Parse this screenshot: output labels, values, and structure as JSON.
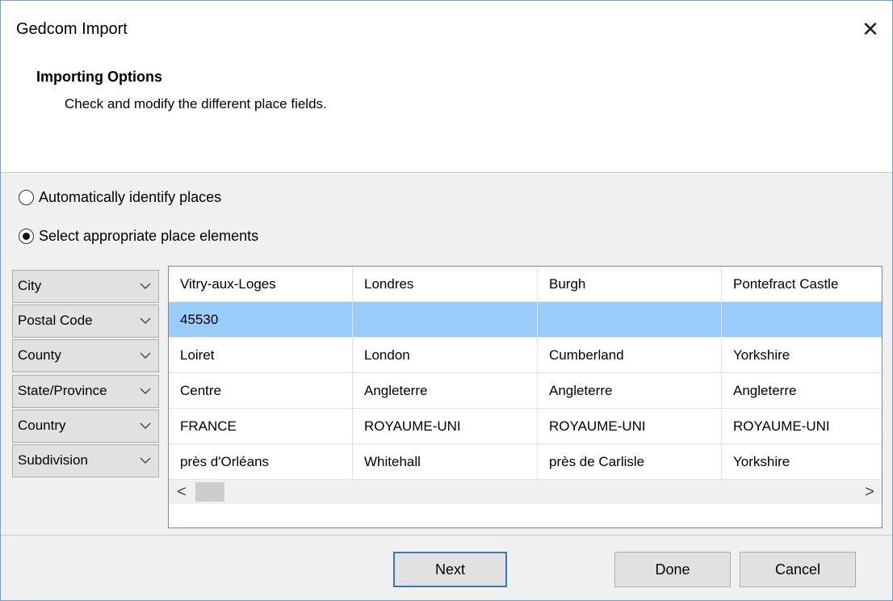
{
  "window": {
    "title": "Gedcom Import",
    "close_glyph": "✕"
  },
  "header": {
    "title": "Importing Options",
    "subtitle": "Check and modify the different place fields."
  },
  "options": {
    "auto_label": "Automatically identify places",
    "select_label": "Select appropriate place elements",
    "selected": "select"
  },
  "fields": [
    {
      "label": "City"
    },
    {
      "label": "Postal Code"
    },
    {
      "label": "County"
    },
    {
      "label": "State/Province"
    },
    {
      "label": "Country"
    },
    {
      "label": "Subdivision"
    }
  ],
  "table": {
    "selected_row": 1,
    "rows": [
      [
        "Vitry-aux-Loges",
        "Londres",
        "Burgh",
        "Pontefract Castle"
      ],
      [
        "45530",
        "",
        "",
        ""
      ],
      [
        "Loiret",
        "London",
        "Cumberland",
        "Yorkshire"
      ],
      [
        "Centre",
        "Angleterre",
        "Angleterre",
        "Angleterre"
      ],
      [
        "FRANCE",
        "ROYAUME-UNI",
        "ROYAUME-UNI",
        "ROYAUME-UNI"
      ],
      [
        "près d'Orléans",
        "Whitehall",
        "près de Carlisle",
        "Yorkshire"
      ]
    ]
  },
  "scrollbar": {
    "left_glyph": "<",
    "right_glyph": ">"
  },
  "buttons": {
    "next": "Next",
    "done": "Done",
    "cancel": "Cancel"
  },
  "colors": {
    "selection": "#99ccf8",
    "default_button_border": "#2f7bc8",
    "window_border": "#6f9fd0"
  }
}
